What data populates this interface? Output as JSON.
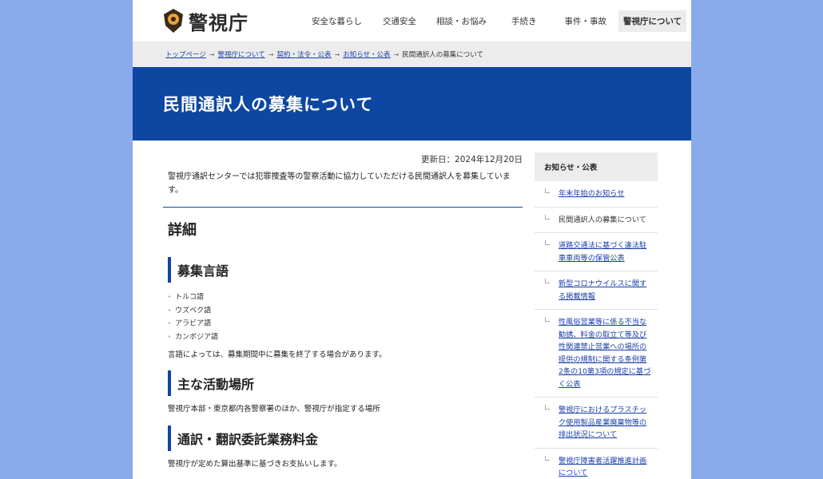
{
  "site": {
    "name": "警視庁"
  },
  "nav": [
    {
      "label": "安全な暮らし"
    },
    {
      "label": "交通安全"
    },
    {
      "label": "相談・お悩み"
    },
    {
      "label": "手続き"
    },
    {
      "label": "事件・事故"
    },
    {
      "label": "警視庁について"
    }
  ],
  "breadcrumb": {
    "items": [
      "トップページ",
      "警視庁について",
      "契約・法令・公表",
      "お知らせ・公表"
    ],
    "current": "民間通訳人の募集について",
    "separator": "→"
  },
  "page": {
    "title": "民間通訳人の募集について",
    "updated": "更新日：2024年12月20日",
    "intro": "警視庁通訳センターでは犯罪捜査等の警察活動に協力していただける民間通訳人を募集しています。"
  },
  "content": {
    "detail_heading": "詳細",
    "languages_heading": "募集言語",
    "languages": [
      "トルコ語",
      "ウズベク語",
      "アラビア語",
      "カンボジア語"
    ],
    "languages_note": "言語によっては、募集期間中に募集を終了する場合があります。",
    "location_heading": "主な活動場所",
    "location_text": "警視庁本部・東京都内各警察署のほか、警視庁が指定する場所",
    "fee_heading": "通訳・翻訳委託業務料金",
    "fee_text": "警視庁が定めた算出基準に基づきお支払いします。"
  },
  "sidebar": {
    "heading": "お知らせ・公表",
    "items": [
      {
        "label": "年末年始のお知らせ"
      },
      {
        "label": "民間通訳人の募集について"
      },
      {
        "label": "道路交通法に基づく違法駐車車両等の保管公表"
      },
      {
        "label": "新型コロナウイルスに関する掲載情報"
      },
      {
        "label": "性風俗営業等に係る不当な勧誘、料金の取立て等及び性関連禁止営業への場所の提供の規制に関する条例第2条の10第3項の規定に基づく公表"
      },
      {
        "label": "警視庁におけるプラスチック使用製品産業廃棄物等の排出状況について"
      },
      {
        "label": "警視庁障害者活躍推進計画について"
      }
    ]
  },
  "colors": {
    "brand": "#0d47a1",
    "background": "#8aabea",
    "link": "#1a3ea8"
  }
}
